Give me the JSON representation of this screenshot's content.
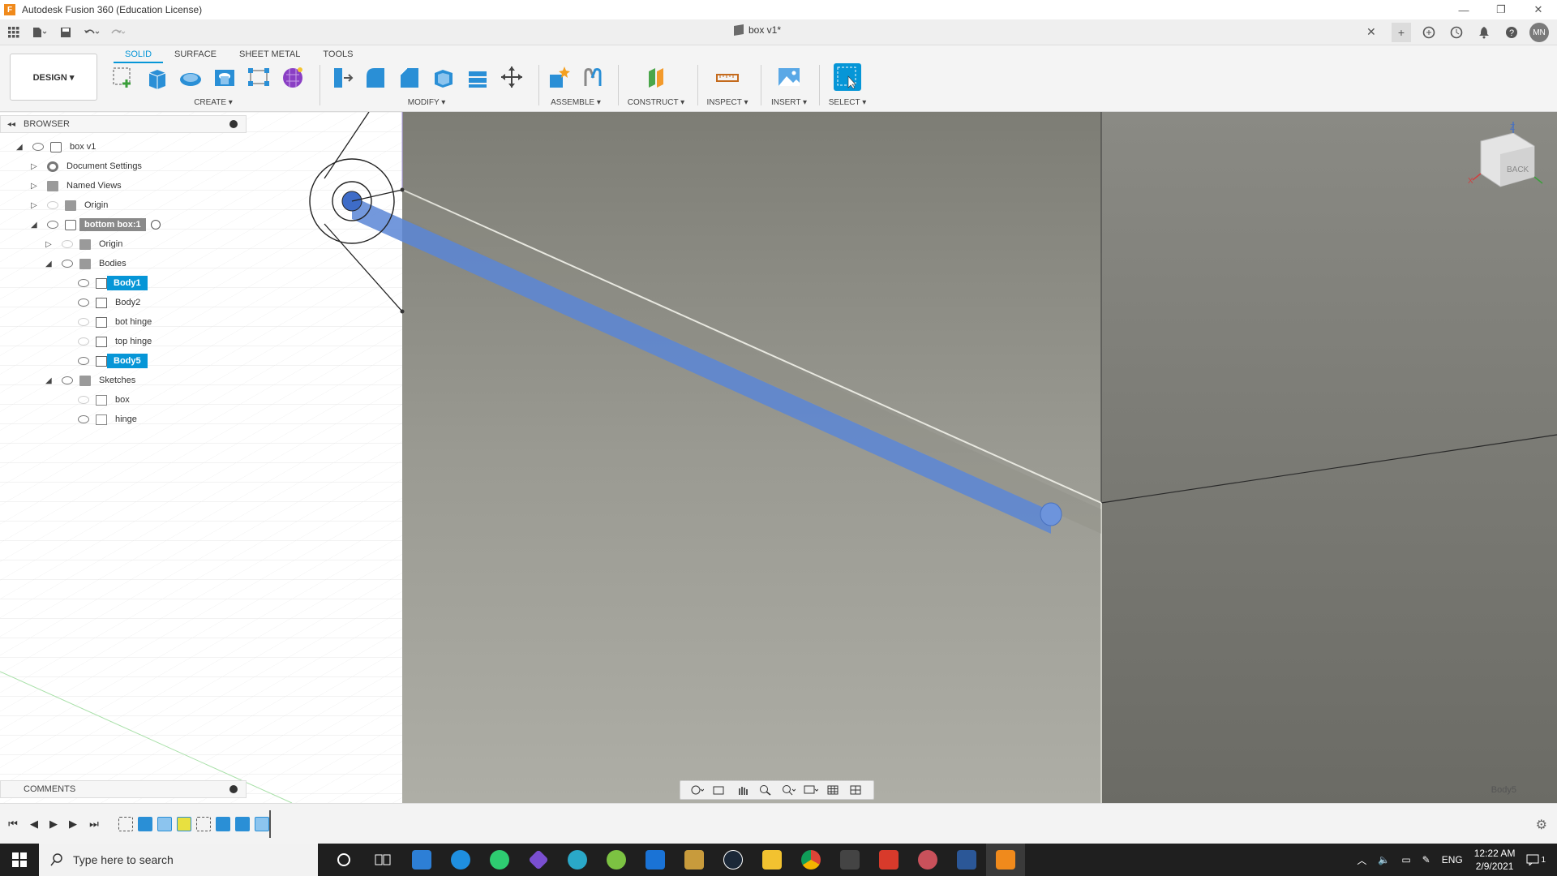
{
  "window": {
    "title": "Autodesk Fusion 360 (Education License)",
    "controls": [
      "—",
      "❐",
      "✕"
    ]
  },
  "docbar": {
    "doc_name": "box v1*",
    "close": "✕",
    "avatar": "MN"
  },
  "ribbon": {
    "workspace": "DESIGN ▾",
    "tabs": [
      "SOLID",
      "SURFACE",
      "SHEET METAL",
      "TOOLS"
    ],
    "groups": {
      "create": "CREATE ▾",
      "modify": "MODIFY ▾",
      "assemble": "ASSEMBLE ▾",
      "construct": "CONSTRUCT ▾",
      "inspect": "INSPECT ▾",
      "insert": "INSERT ▾",
      "select": "SELECT ▾"
    }
  },
  "browser": {
    "title": "BROWSER",
    "collapse_icon": "◂◂",
    "items": [
      {
        "label": "box v1"
      },
      {
        "label": "Document Settings"
      },
      {
        "label": "Named Views"
      },
      {
        "label": "Origin"
      },
      {
        "label": "bottom box:1"
      },
      {
        "label": "Origin"
      },
      {
        "label": "Bodies"
      },
      {
        "label": "Body1"
      },
      {
        "label": "Body2"
      },
      {
        "label": "bot hinge"
      },
      {
        "label": "top hinge"
      },
      {
        "label": "Body5"
      },
      {
        "label": "Sketches"
      },
      {
        "label": "box"
      },
      {
        "label": "hinge"
      }
    ]
  },
  "comments": {
    "title": "COMMENTS"
  },
  "viewcube": {
    "face": "BACK",
    "axis_z": "Z",
    "axis_x": "X"
  },
  "status": {
    "selection": "Body5"
  },
  "taskbar": {
    "search_placeholder": "Type here to search",
    "lang": "ENG",
    "time": "12:22 AM",
    "date": "2/9/2021",
    "notif_count": "1"
  },
  "colors": {
    "accent": "#0696d7",
    "selected_body": "#5b86d6",
    "background": "#ffffff",
    "model_face_light": "#a8a8a0",
    "model_face_dark": "#7c7c76"
  }
}
